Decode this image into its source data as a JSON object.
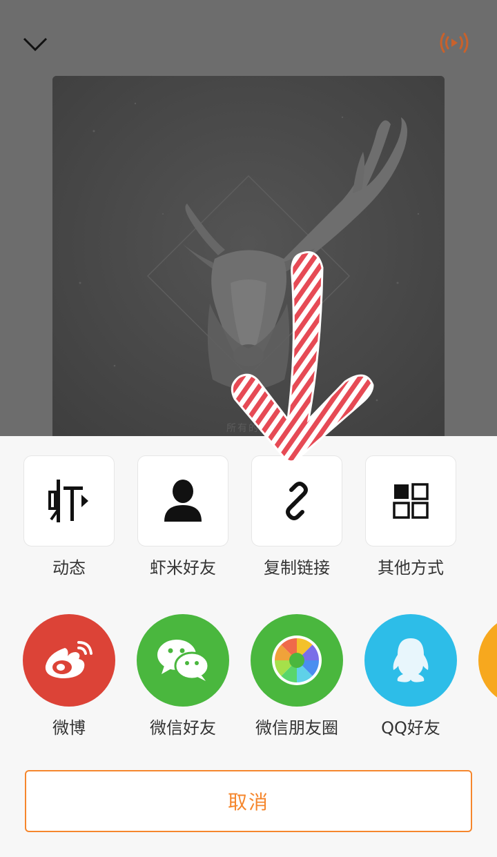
{
  "player": {
    "album_caption": "所有的道",
    "collapse_icon": "chevron-down-icon",
    "broadcast_icon": "broadcast-play-icon",
    "accent_color": "#c9612b"
  },
  "share_sheet": {
    "app_items": [
      {
        "label": "动态",
        "icon": "xiami-logo-icon"
      },
      {
        "label": "虾米好友",
        "icon": "person-icon"
      },
      {
        "label": "复制链接",
        "icon": "link-icon"
      },
      {
        "label": "其他方式",
        "icon": "grid-icon"
      }
    ],
    "social_items": [
      {
        "label": "微博",
        "icon": "weibo-icon",
        "color": "#dc4337"
      },
      {
        "label": "微信好友",
        "icon": "wechat-icon",
        "color": "#4ab73e"
      },
      {
        "label": "微信朋友圈",
        "icon": "moments-icon",
        "color": "#4ab73e"
      },
      {
        "label": "QQ好友",
        "icon": "qq-icon",
        "color": "#2dbde8"
      }
    ],
    "cancel_label": "取消",
    "accent_color": "#f5862c"
  }
}
